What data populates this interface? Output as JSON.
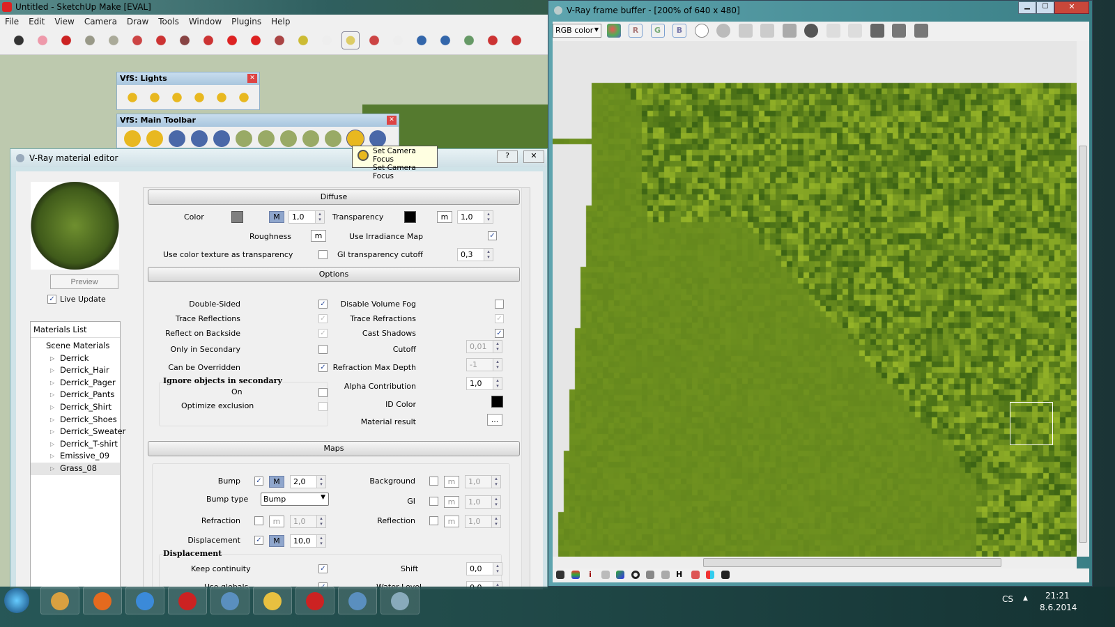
{
  "sketchup": {
    "title": "Untitled - SketchUp Make [EVAL]",
    "menu": [
      "File",
      "Edit",
      "View",
      "Camera",
      "Draw",
      "Tools",
      "Window",
      "Plugins",
      "Help"
    ],
    "tools": [
      "select",
      "eraser",
      "pencil",
      "rectangle",
      "circle",
      "polygon",
      "arc",
      "push-pull",
      "follow-me",
      "move",
      "rotate",
      "scale",
      "tape-measure",
      "text",
      "paint-bucket",
      "orbit",
      "pan",
      "zoom",
      "zoom-extents",
      "map",
      "warehouse",
      "extension"
    ]
  },
  "lights_toolbar": {
    "title": "VfS: Lights",
    "icons": [
      "omni-light",
      "rectangle-light",
      "spot-light",
      "dome-light",
      "sphere-light",
      "ies-light"
    ]
  },
  "main_toolbar": {
    "title": "VfS: Main Toolbar",
    "icons": [
      "M",
      "material-editor",
      "R",
      "RT",
      "help",
      "light-gen",
      "sphere",
      "infinite-plane",
      "proxy-export",
      "proxy-import",
      "camera-focus",
      "pause"
    ]
  },
  "tooltip": {
    "title": "Set Camera Focus",
    "text": "Set Camera Focus"
  },
  "editor": {
    "title": "V-Ray material editor",
    "help": "?",
    "close": "✕",
    "preview": "Preview",
    "live_update": "Live Update",
    "materials_header": "Materials List",
    "scene_materials": "Scene Materials",
    "materials": [
      "Derrick",
      "Derrick_Hair",
      "Derrick_Pager",
      "Derrick_Pants",
      "Derrick_Shirt",
      "Derrick_Shoes",
      "Derrick_Sweater",
      "Derrick_T-shirt",
      "Emissive_09",
      "Grass_08"
    ],
    "selected_material": "Grass_08",
    "diffuse": {
      "header": "Diffuse",
      "color": "Color",
      "color_swatch": "#808080",
      "color_m": "M",
      "color_val": "1,0",
      "transparency": "Transparency",
      "transparency_swatch": "#000000",
      "transparency_m": "m",
      "transparency_val": "1,0",
      "roughness": "Roughness",
      "roughness_m": "m",
      "use_irradiance": "Use Irradiance Map",
      "use_color_tex": "Use color texture as transparency",
      "gi_cutoff": "GI transparency cutoff",
      "gi_cutoff_val": "0,3"
    },
    "options": {
      "header": "Options",
      "double_sided": "Double-Sided",
      "trace_reflections": "Trace Reflections",
      "reflect_backside": "Reflect on Backside",
      "only_secondary": "Only in Secondary",
      "can_override": "Can be Overridden",
      "ignore_group": "Ignore objects in secondary",
      "on": "On",
      "optimize": "Optimize exclusion",
      "disable_fog": "Disable Volume Fog",
      "trace_refractions": "Trace Refractions",
      "cast_shadows": "Cast Shadows",
      "cutoff": "Cutoff",
      "cutoff_val": "0,01",
      "refr_depth": "Refraction Max Depth",
      "refr_depth_val": "-1",
      "alpha": "Alpha Contribution",
      "alpha_val": "1,0",
      "id_color": "ID Color",
      "material_result": "Material result",
      "dots": "..."
    },
    "maps": {
      "header": "Maps",
      "bump": "Bump",
      "bump_m": "M",
      "bump_val": "2,0",
      "bump_type": "Bump type",
      "bump_type_val": "Bump",
      "refraction": "Refraction",
      "refraction_m": "m",
      "refraction_val": "1,0",
      "displacement": "Displacement",
      "displacement_m": "M",
      "displacement_val": "10,0",
      "background": "Background",
      "background_m": "m",
      "background_val": "1,0",
      "gi": "GI",
      "gi_m": "m",
      "gi_val": "1,0",
      "reflection": "Reflection",
      "reflection_m": "m",
      "reflection_val": "1,0"
    },
    "displacement": {
      "header": "Displacement",
      "keep_continuity": "Keep continuity",
      "shift": "Shift",
      "shift_val": "0,0",
      "use_globals": "Use globals",
      "water_level": "Water Level",
      "water_val": "0,0"
    }
  },
  "framebuffer": {
    "title": "V-Ray frame buffer - [200% of 640 x 480]",
    "channel": "RGB color",
    "r": "R",
    "g": "G",
    "b": "B"
  },
  "taskbar": {
    "lang": "CS",
    "time": "21:21",
    "date": "8.6.2014",
    "apps": [
      "explorer",
      "firefox",
      "chrome",
      "opera",
      "remote",
      "mail",
      "sketchup",
      "photo-viewer",
      "paint"
    ]
  }
}
